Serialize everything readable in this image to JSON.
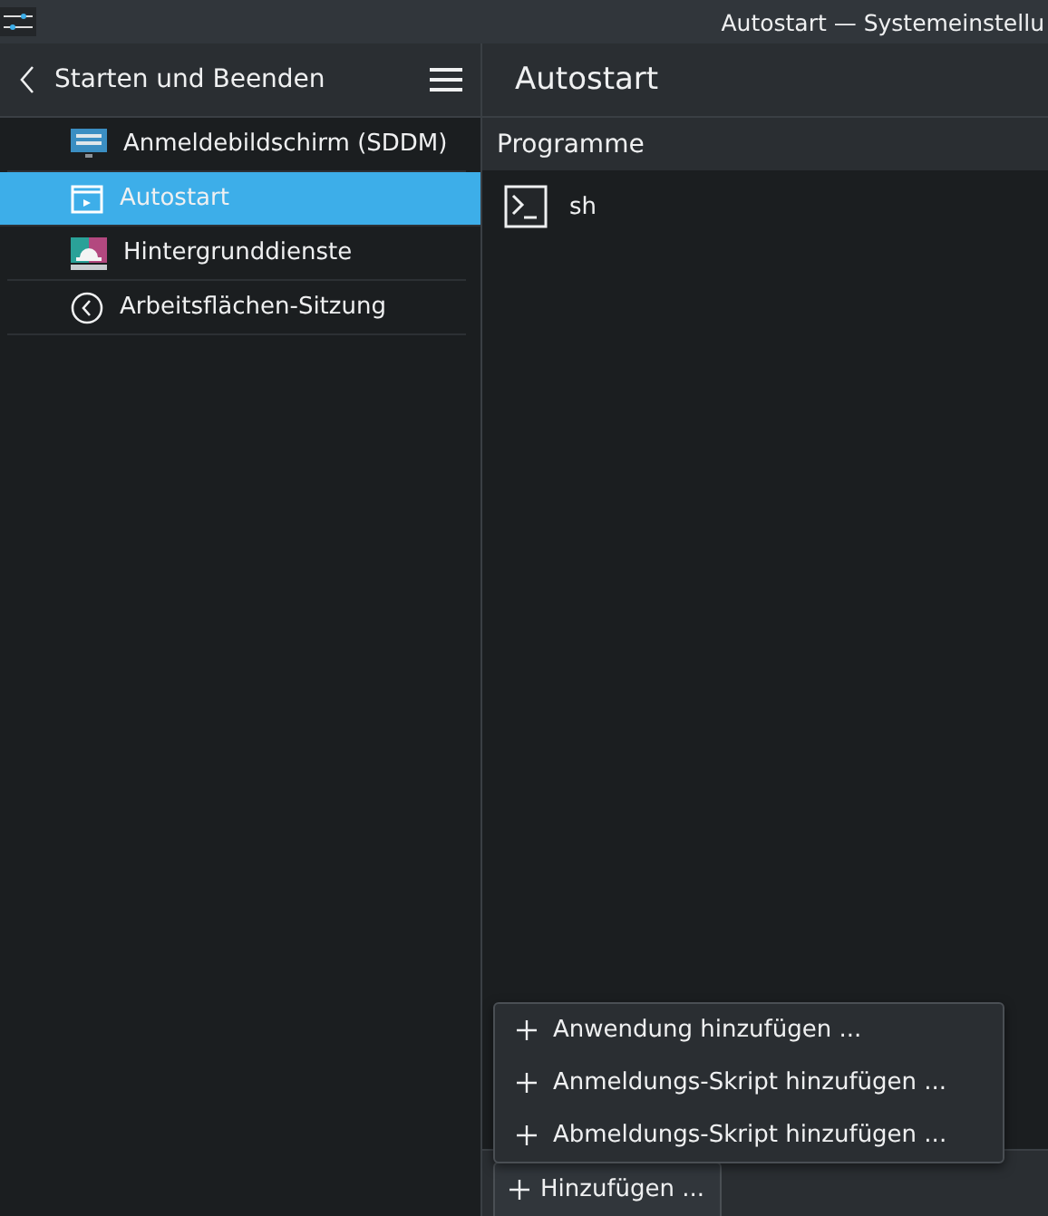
{
  "window": {
    "title": "Autostart — Systemeinstellu"
  },
  "sidebar": {
    "back_title": "Starten und Beenden",
    "items": [
      {
        "kind": "monitor",
        "label": "Anmeldebildschirm (SDDM)",
        "selected": false
      },
      {
        "kind": "window",
        "label": "Autostart",
        "selected": true
      },
      {
        "kind": "bell",
        "label": "Hintergrunddienste",
        "selected": false
      },
      {
        "kind": "session",
        "label": "Arbeitsflächen-Sitzung",
        "selected": false
      }
    ]
  },
  "page": {
    "title": "Autostart",
    "list_header": "Programme",
    "programs": [
      {
        "name": "sh"
      }
    ]
  },
  "menu": {
    "items": [
      {
        "label": "Anwendung hinzufügen ..."
      },
      {
        "label": "Anmeldungs-Skript hinzufügen ..."
      },
      {
        "label": "Abmeldungs-Skript hinzufügen ..."
      }
    ]
  },
  "footer": {
    "button": "Hinzufügen ..."
  }
}
